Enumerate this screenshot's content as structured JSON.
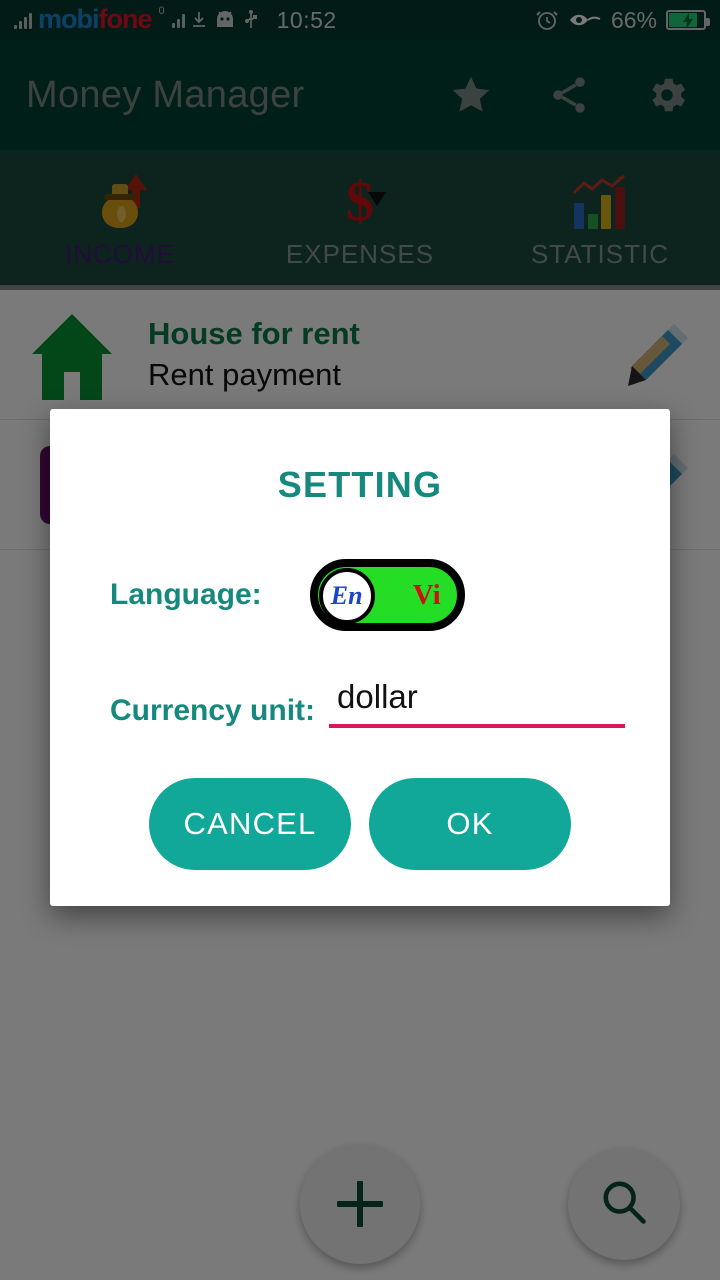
{
  "statusbar": {
    "carrier_mobi": "mobi",
    "carrier_fone": "fone",
    "carrier_sup": "0",
    "time": "10:52",
    "battery_percent": "66%",
    "icons": [
      "signal-icon",
      "download-icon",
      "android-icon",
      "usb-icon",
      "alarm-icon",
      "eye-icon",
      "battery-charging-icon"
    ]
  },
  "actionbar": {
    "title": "Money Manager",
    "icons": [
      "star-icon",
      "share-icon",
      "gear-icon"
    ]
  },
  "tabs": [
    {
      "label": "INCOME",
      "icon": "money-bag-icon",
      "active": true
    },
    {
      "label": "EXPENSES",
      "icon": "dollar-sign-icon",
      "active": false
    },
    {
      "label": "STATISTIC",
      "icon": "bar-chart-icon",
      "active": false
    }
  ],
  "list": [
    {
      "icon": "house-icon",
      "title": "House for rent",
      "subtitle": "Rent payment",
      "action_icon": "pencil-icon"
    }
  ],
  "fabs": [
    {
      "name": "add-fab",
      "icon": "plus-icon"
    },
    {
      "name": "search-fab",
      "icon": "magnifier-icon"
    }
  ],
  "dialog": {
    "title": "SETTING",
    "language_label": "Language:",
    "language_toggle": {
      "on_label": "En",
      "off_label": "Vi",
      "selected": "En",
      "track_color": "#25dd25",
      "on_text_color": "#1b45c9",
      "off_text_color": "#cf0f0f"
    },
    "currency_label": "Currency unit:",
    "currency_value": "dollar",
    "currency_placeholder": "dollar",
    "currency_underline_color": "#d81b56",
    "cancel_label": "CANCEL",
    "ok_label": "OK",
    "accent_color": "#11a89a",
    "title_color": "#16897e"
  }
}
